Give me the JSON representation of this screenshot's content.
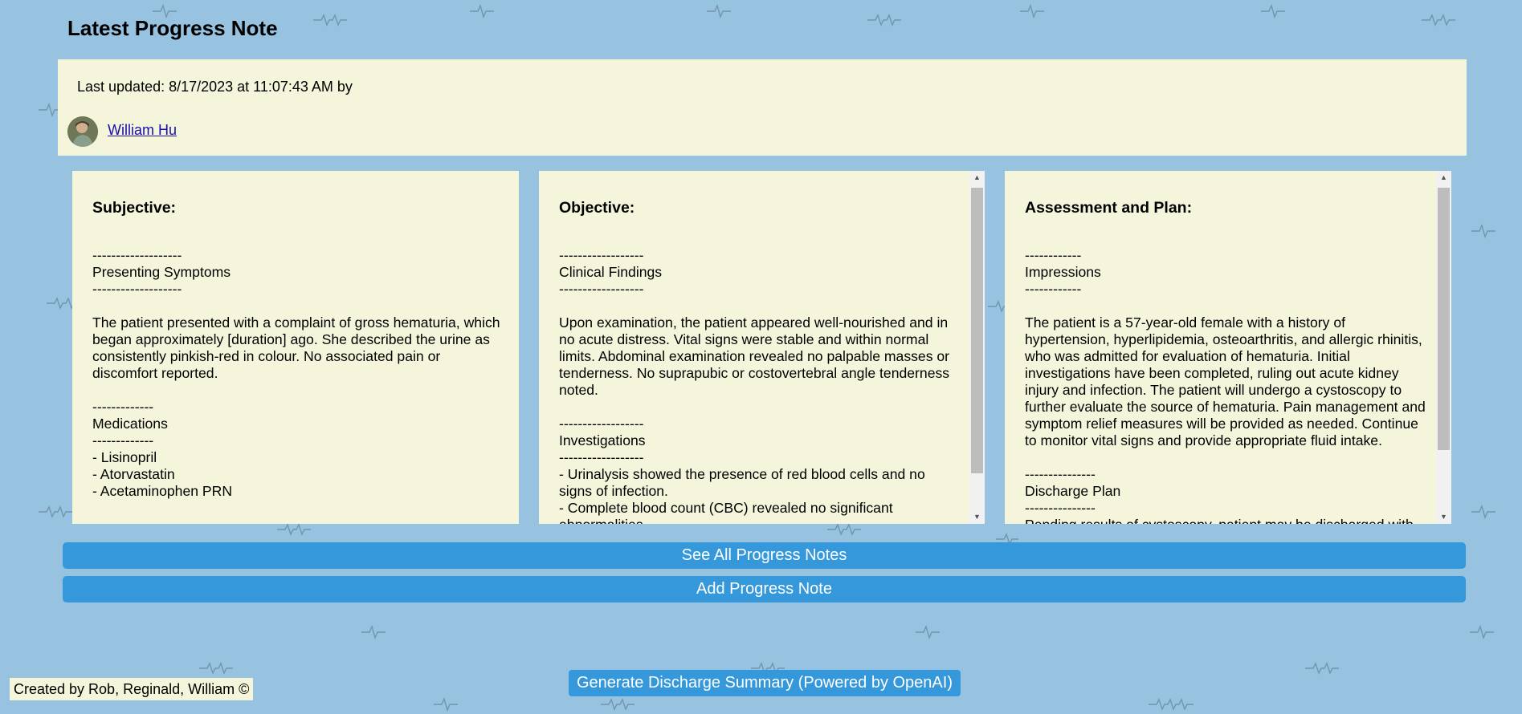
{
  "page": {
    "title": "Latest Progress Note"
  },
  "update": {
    "text": "Last updated: 8/17/2023 at 11:07:43 AM by",
    "author": "William Hu"
  },
  "notes": [
    {
      "heading": "Subjective:",
      "body": "-------------------\nPresenting Symptoms\n-------------------\n\nThe patient presented with a complaint of gross hematuria, which began approximately [duration] ago. She described the urine as consistently pinkish-red in colour. No associated pain or discomfort reported.\n\n-------------\nMedications\n-------------\n- Lisinopril\n- Atorvastatin\n- Acetaminophen PRN"
    },
    {
      "heading": "Objective:",
      "body": "------------------\nClinical Findings\n------------------\n\nUpon examination, the patient appeared well-nourished and in no acute distress. Vital signs were stable and within normal limits. Abdominal examination revealed no palpable masses or tenderness. No suprapubic or costovertebral angle tenderness noted.\n\n------------------\nInvestigations\n------------------\n- Urinalysis showed the presence of red blood cells and no signs of infection.\n- Complete blood count (CBC) revealed no significant abnormalities."
    },
    {
      "heading": "Assessment and Plan:",
      "body": "------------\nImpressions\n------------\n\nThe patient is a 57-year-old female with a history of hypertension, hyperlipidemia, osteoarthritis, and allergic rhinitis, who was admitted for evaluation of hematuria. Initial investigations have been completed, ruling out acute kidney injury and infection. The patient will undergo a cystoscopy to further evaluate the source of hematuria. Pain management and symptom relief measures will be provided as needed. Continue to monitor vital signs and provide appropriate fluid intake.\n\n---------------\nDischarge Plan\n---------------\nPending results of cystoscopy, patient may be discharged with"
    }
  ],
  "buttons": {
    "see_all": "See All Progress Notes",
    "add_note": "Add Progress Note",
    "discharge": "Generate Discharge Summary (Powered by OpenAI)"
  },
  "footer": {
    "credit": "Created by Rob, Reginald, William ©"
  },
  "colors": {
    "background": "#97c3e0",
    "panel": "#f5f5dc",
    "button": "#3498db",
    "link": "#1a0dab"
  },
  "icons": {
    "scroll_up": "scroll-up-arrow-icon",
    "scroll_down": "scroll-down-arrow-icon",
    "background_pattern": "ecg-heartbeat-pattern-icon"
  }
}
